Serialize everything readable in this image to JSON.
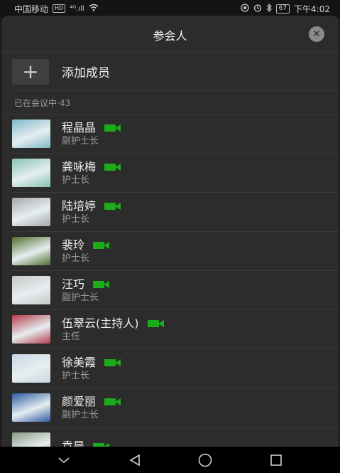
{
  "status": {
    "carrier": "中国移动",
    "hd": "HD",
    "signal": "⁴ᴳ.ıll",
    "time": "下午4:02",
    "battery": "67"
  },
  "sheet": {
    "title": "参会人",
    "add_label": "添加成员",
    "section_label": "已在会议中·43"
  },
  "members": [
    {
      "name": "程晶晶",
      "role": "副护士长",
      "avatar": "lake-icon",
      "color": "#7fb9c9"
    },
    {
      "name": "龚咏梅",
      "role": "护士长",
      "avatar": "flowers-flag-icon",
      "color": "#86c3b1"
    },
    {
      "name": "陆培婷",
      "role": "护士长",
      "avatar": "portrait-icon",
      "color": "#a4a8ad"
    },
    {
      "name": "裴玲",
      "role": "护士长",
      "avatar": "lantern-fruit-icon",
      "color": "#4f6c2e"
    },
    {
      "name": "汪巧",
      "role": "副护士长",
      "avatar": "dancer-icon",
      "color": "#c7c7c7"
    },
    {
      "name": "伍翠云(主持人)",
      "role": "主任",
      "avatar": "red-flowers-icon",
      "color": "#b63b4c"
    },
    {
      "name": "徐美霞",
      "role": "护士长",
      "avatar": "iris-flower-icon",
      "color": "#c9d8e5"
    },
    {
      "name": "颜爱丽",
      "role": "副护士长",
      "avatar": "cloud-icon",
      "color": "#2c58a1"
    },
    {
      "name": "袁晨",
      "role": "",
      "avatar": "landscape-icon",
      "color": "#8a9b85"
    }
  ]
}
